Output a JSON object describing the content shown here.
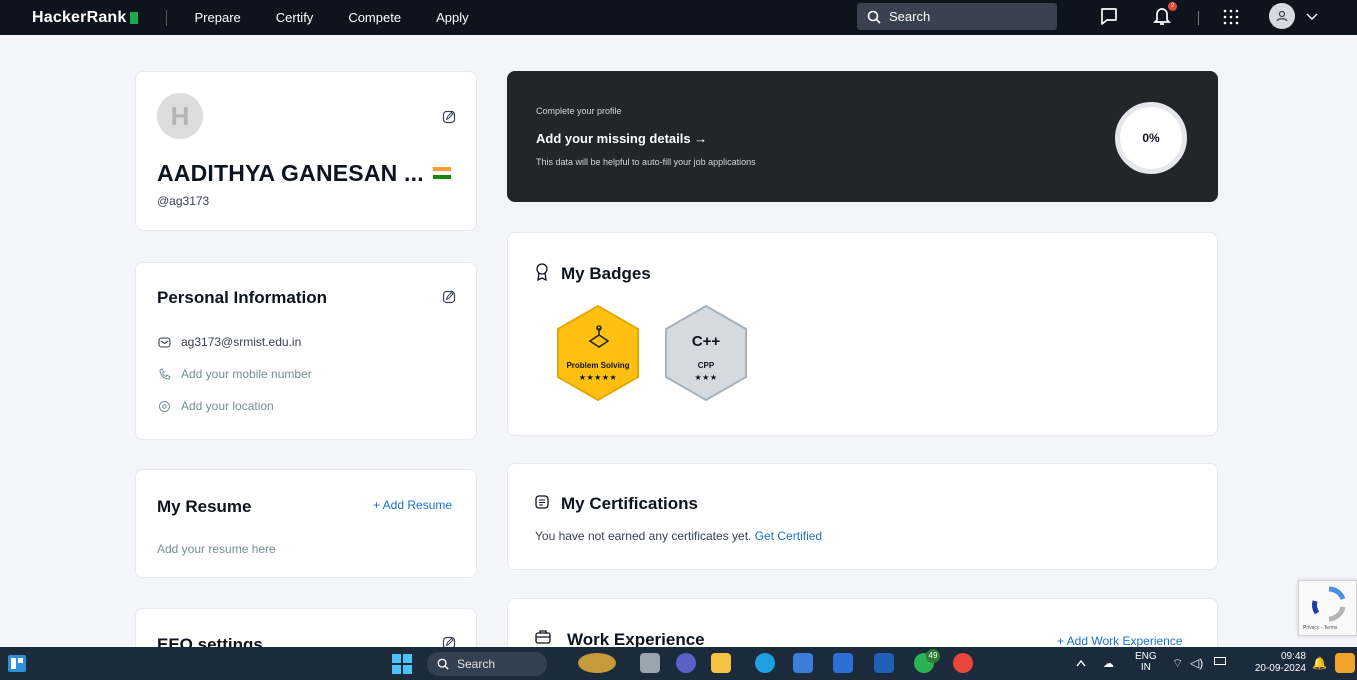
{
  "header": {
    "logo": "HackerRank",
    "nav": [
      "Prepare",
      "Certify",
      "Compete",
      "Apply"
    ],
    "search_placeholder": "Search",
    "notification_count": "2"
  },
  "profile": {
    "name": "AADITHYA GANESAN ...",
    "handle": "@ag3173",
    "avatar_letter": "H"
  },
  "personal_info": {
    "title": "Personal Information",
    "email": "ag3173@srmist.edu.in",
    "phone_placeholder": "Add your mobile number",
    "location_placeholder": "Add your location"
  },
  "resume": {
    "title": "My Resume",
    "add_label": "+ Add Resume",
    "placeholder": "Add your resume here"
  },
  "eeo": {
    "title": "EEO settings"
  },
  "banner": {
    "small": "Complete your profile",
    "heading": "Add your missing details →",
    "desc": "This data will be helpful to auto-fill your job applications",
    "progress": "0%",
    "progress_value": 0
  },
  "badges": {
    "title": "My Badges",
    "items": [
      {
        "label": "Problem Solving",
        "stars": "★★★★★",
        "color": "#ffc012"
      },
      {
        "label": "CPP",
        "logo": "C++",
        "stars": "★★★",
        "color": "#d4dadf"
      }
    ]
  },
  "certifications": {
    "title": "My Certifications",
    "text": "You have not earned any certificates yet.",
    "link": "Get Certified"
  },
  "work": {
    "title": "Work Experience",
    "add_label": "+ Add Work Experience"
  },
  "recaptcha": {
    "text": "Privacy - Terms"
  },
  "taskbar": {
    "search": "Search",
    "whatsapp_badge": "49",
    "lang_top": "ENG",
    "lang_bottom": "IN",
    "time": "09:48",
    "date": "20-09-2024"
  },
  "colors": {
    "nav_bg": "#0e141e",
    "accent_green": "#1ba94c",
    "link_blue": "#1a73c7",
    "badge_gold": "#ffc012",
    "badge_silver": "#d4dadf"
  }
}
